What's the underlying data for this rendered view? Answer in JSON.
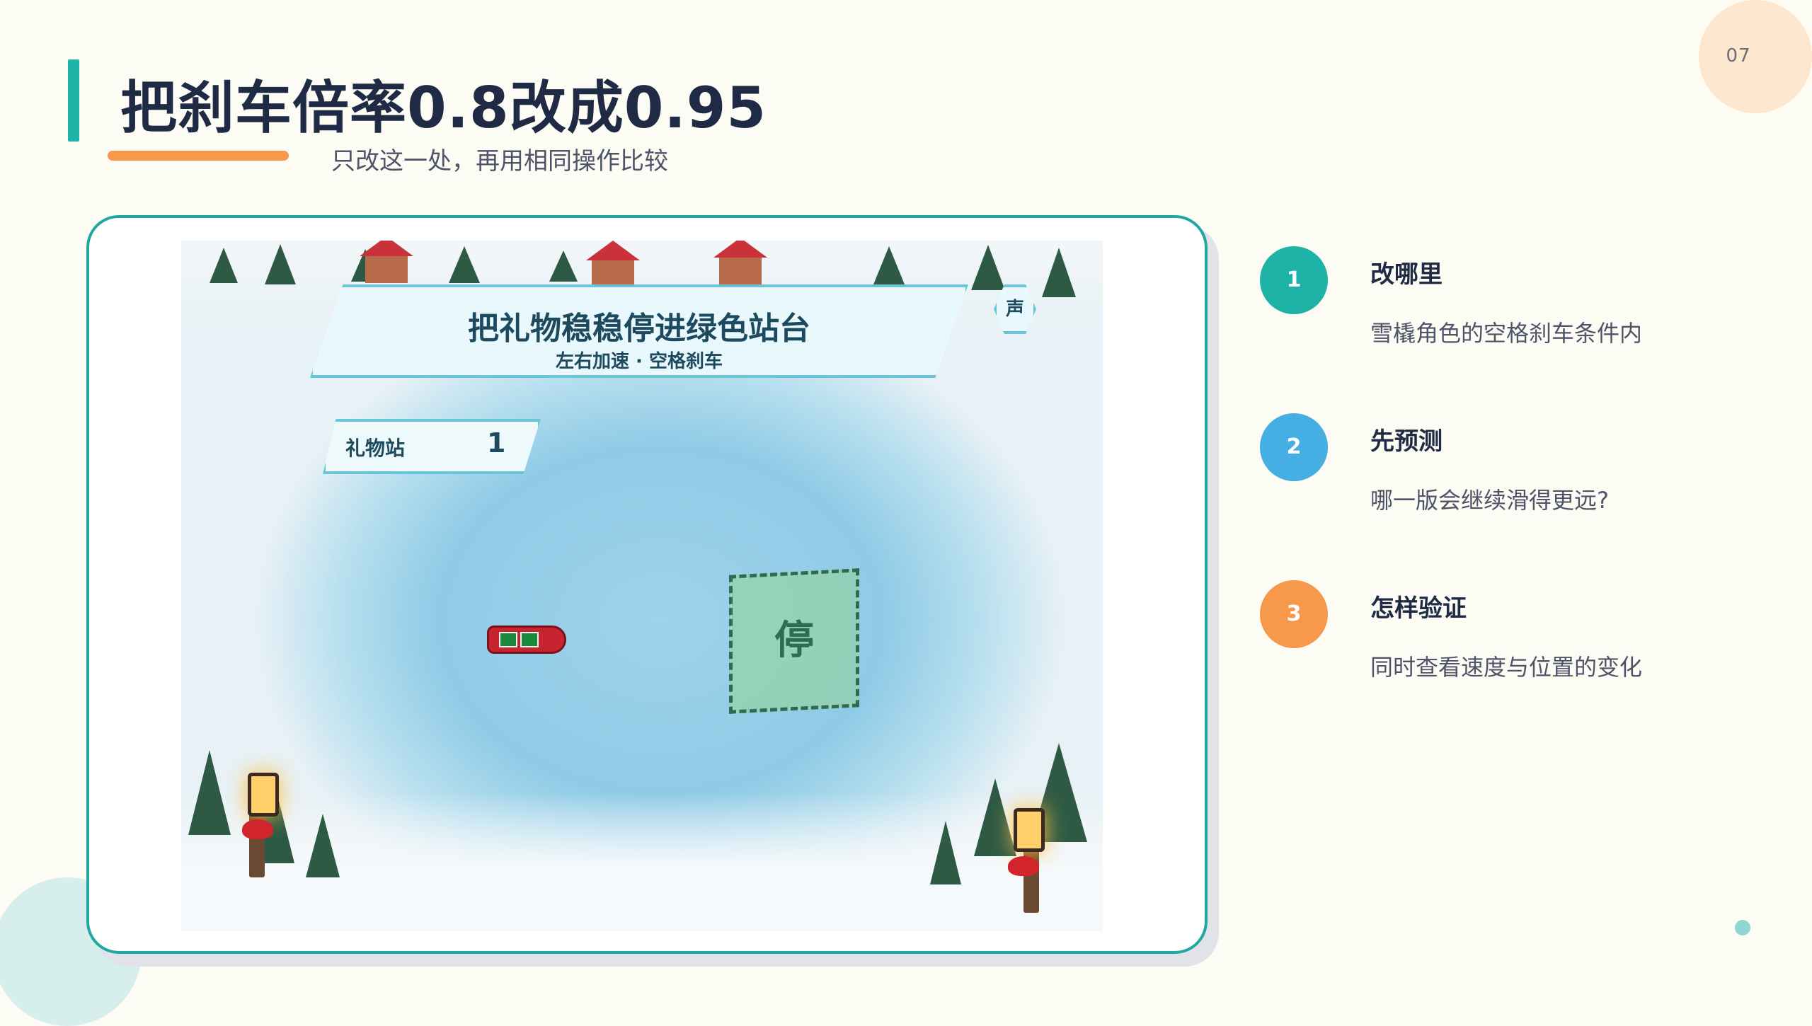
{
  "page_number": "07",
  "title": "把刹车倍率0.8改成0.95",
  "subtitle": "只改这一处，再用相同操作比较",
  "colors": {
    "teal": "#1fb3a7",
    "orange": "#f7994b",
    "blue": "#45aee3",
    "navy": "#1f2a44"
  },
  "game": {
    "banner_title": "把礼物稳稳停进绿色站台",
    "banner_subtitle": "左右加速 · 空格刹车",
    "sound_label": "声",
    "station_label": "礼物站",
    "station_count": "1",
    "stop_zone_label": "停"
  },
  "steps": [
    {
      "number": "1",
      "title": "改哪里",
      "description": "雪橇角色的空格刹车条件内",
      "color": "#1fb3a7"
    },
    {
      "number": "2",
      "title": "先预测",
      "description": "哪一版会继续滑得更远?",
      "color": "#45aee3"
    },
    {
      "number": "3",
      "title": "怎样验证",
      "description": "同时查看速度与位置的变化",
      "color": "#f7994b"
    }
  ]
}
